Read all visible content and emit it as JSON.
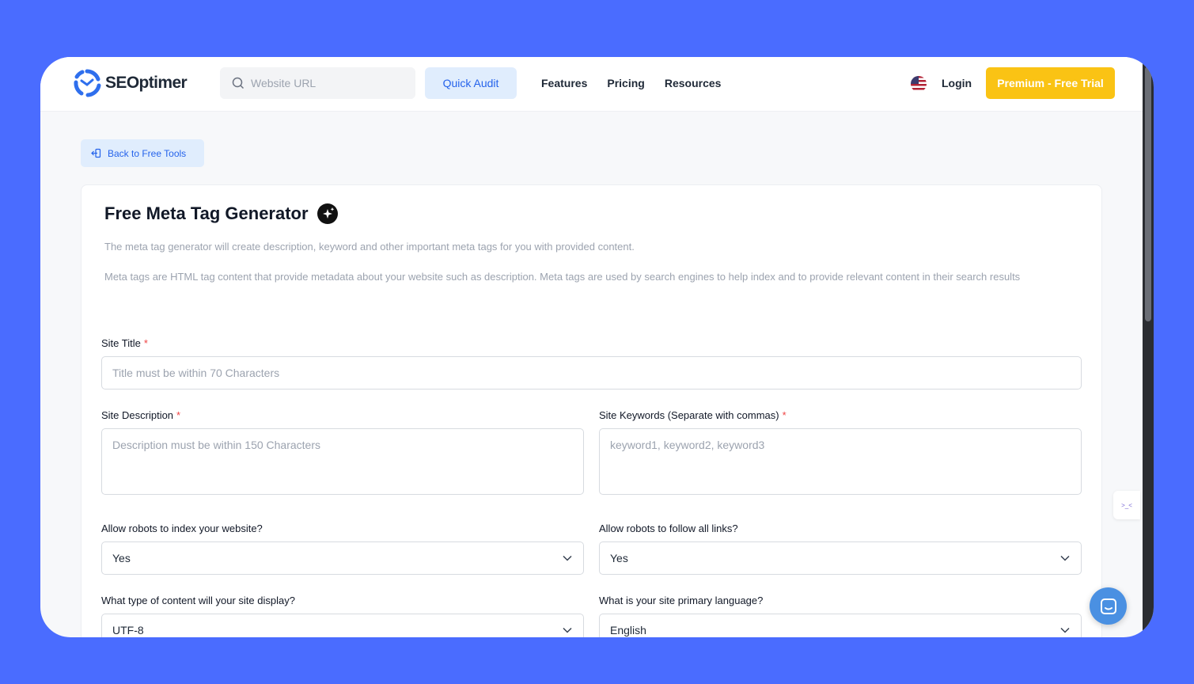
{
  "header": {
    "logo_text": "SEOptimer",
    "search_placeholder": "Website URL",
    "quick_audit_label": "Quick Audit",
    "nav": [
      "Features",
      "Pricing",
      "Resources"
    ],
    "login_label": "Login",
    "premium_label": "Premium - Free Trial"
  },
  "back_label": "Back to Free Tools",
  "card": {
    "title": "Free Meta Tag Generator",
    "desc1": "The meta tag generator will create description, keyword and other important meta tags for you with provided content.",
    "desc2": "Meta tags are HTML tag content that provide metadata about your website such as description. Meta tags are used by search engines to help index and to provide relevant content in their search results"
  },
  "form": {
    "site_title_label": "Site Title",
    "site_title_placeholder": "Title must be within 70 Characters",
    "site_desc_label": "Site Description",
    "site_desc_placeholder": "Description must be within 150 Characters",
    "site_keywords_label": "Site Keywords (Separate with commas)",
    "site_keywords_placeholder": "keyword1, keyword2, keyword3",
    "required_mark": "*",
    "index_label": "Allow robots to index your website?",
    "index_value": "Yes",
    "follow_label": "Allow robots to follow all links?",
    "follow_value": "Yes",
    "content_type_label": "What type of content will your site display?",
    "content_type_value": "UTF-8",
    "language_label": "What is your site primary language?",
    "language_value": "English"
  },
  "side_widget_text": ">_<",
  "colors": {
    "background": "#4a6cff",
    "accent_blue": "#2563eb",
    "premium_yellow": "#fac314",
    "chat_blue": "#4a90e2"
  }
}
